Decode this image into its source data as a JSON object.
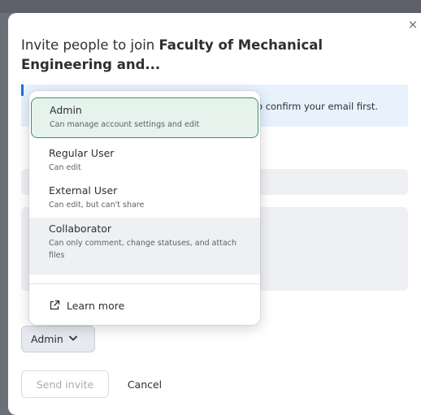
{
  "modal": {
    "title_prefix": "Invite people to join ",
    "title_bold": "Faculty of Mechanical Engineering and...",
    "close_icon": "×",
    "info_banner_text": "o confirm your email first."
  },
  "dropdown": {
    "options": [
      {
        "label": "Admin",
        "description": "Can manage account settings and edit",
        "selected": true
      },
      {
        "label": "Regular User",
        "description": "Can edit",
        "selected": false
      },
      {
        "label": "External User",
        "description": "Can edit, but can't share",
        "selected": false
      },
      {
        "label": "Collaborator",
        "description": "Can only comment, change statuses, and attach files",
        "selected": false
      }
    ],
    "learn_more_label": "Learn more",
    "learn_more_icon": "external-link-icon"
  },
  "role_select": {
    "value": "Admin",
    "chevron": "⌄"
  },
  "actions": {
    "send_label": "Send invite",
    "cancel_label": "Cancel"
  },
  "colors": {
    "selected_bg": "#e5f3ec",
    "selected_border": "#3d8f6a",
    "info_bg": "#e8f2fd",
    "info_accent": "#1f6fd1",
    "hover_bg": "#eef0f4"
  }
}
